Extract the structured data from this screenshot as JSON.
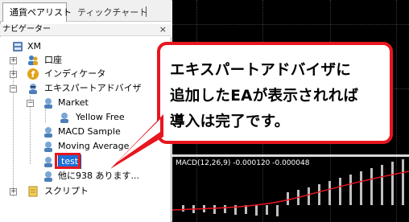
{
  "tabs": [
    {
      "label": "通貨ペアリスト",
      "active": true
    },
    {
      "label": "ティックチャート",
      "active": false
    }
  ],
  "navigator": {
    "title": "ナビゲーター",
    "close_glyph": "×",
    "items": [
      {
        "label": "XM",
        "icon": "server-icon"
      },
      {
        "label": "口座",
        "icon": "accounts-icon"
      },
      {
        "label": "インディケータ",
        "icon": "indicators-icon"
      },
      {
        "label": "エキスパートアドバイザ",
        "icon": "expert-advisors-icon"
      },
      {
        "label": "Market",
        "icon": "folder-icon"
      },
      {
        "label": "Yellow Free",
        "icon": "ea-icon"
      },
      {
        "label": "MACD Sample",
        "icon": "ea-icon"
      },
      {
        "label": "Moving Average",
        "icon": "ea-icon"
      },
      {
        "label": "test",
        "icon": "ea-icon",
        "selected": true
      },
      {
        "label": "他に938 あります...",
        "icon": "ea-icon"
      },
      {
        "label": "スクリプト",
        "icon": "scripts-icon"
      }
    ]
  },
  "chart": {
    "indicator_label": "MACD(12,26,9) -0.000120 -0.000048",
    "background": "#000000",
    "histogram_color": "#c0c0c0",
    "signal_color": "#e8161e"
  },
  "callout": {
    "lines": [
      "エキスパートアドバイザに",
      "追加したEAが表示されれば",
      "導入は完了です。"
    ],
    "border_color": "#e8161e"
  }
}
